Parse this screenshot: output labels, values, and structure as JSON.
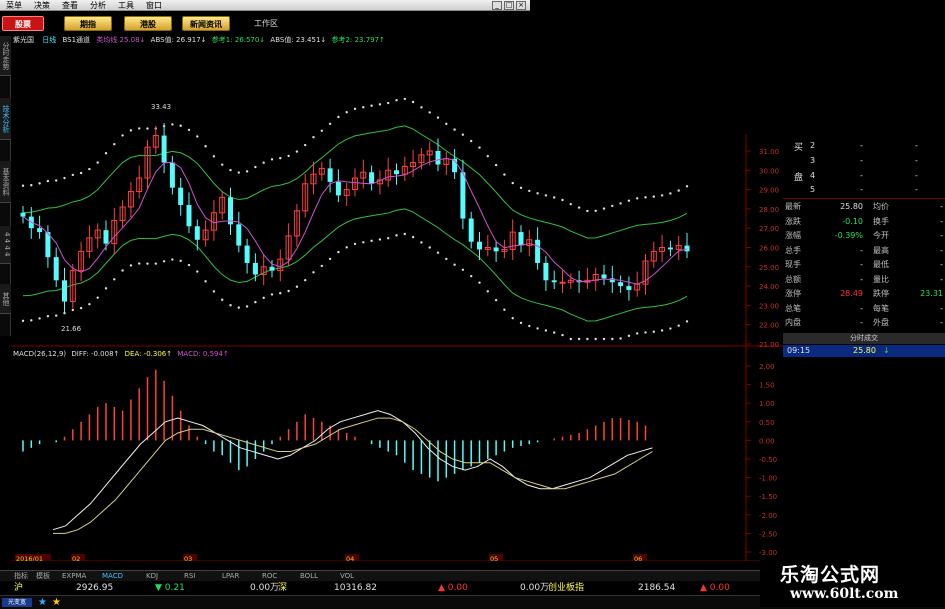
{
  "menu": {
    "items": [
      "菜单",
      "决策",
      "查看",
      "分析",
      "工具",
      "窗口"
    ],
    "window_buttons": [
      "_",
      "□",
      "×"
    ]
  },
  "toolbar": {
    "stock": "股票",
    "futures": "期指",
    "hk": "港股",
    "news": "新闻资讯",
    "workarea": "工作区"
  },
  "left_tabs": [
    "分时走势",
    "技术分析",
    "基本资料",
    "4 4 4 4",
    "其他"
  ],
  "info_header": {
    "name": "紫光国",
    "period": "日线",
    "indicator": "BS1通道",
    "ma_label": "类均线",
    "ma_value": "25.08↓",
    "abs1_label": "ABS值:",
    "abs1_value": "26.917↓",
    "ref1_label": "参考1:",
    "ref1_value": "26.570↓",
    "abs2_label": "ABS值:",
    "abs2_value": "23.451↓",
    "ref2_label": "参考2:",
    "ref2_value": "23.797↑"
  },
  "macd_header": {
    "label": "MACD(26,12,9)",
    "diff": "DIFF: -0.008↑",
    "dea": "DEA: -0.306↑",
    "macd": "MACD: 0.594↑"
  },
  "price_axis": [
    "31.00",
    "30.00",
    "29.00",
    "28.00",
    "27.00",
    "26.00",
    "25.00",
    "24.00",
    "23.00",
    "22.00",
    "21.00"
  ],
  "macd_axis": [
    "2.00",
    "1.50",
    "1.00",
    "0.50",
    "0.00",
    "-0.50",
    "-1.00",
    "-1.50",
    "-2.00",
    "-2.50",
    "-3.00"
  ],
  "annotations": {
    "high": "33.43",
    "low": "21.66"
  },
  "bid_ask": {
    "buy_label": "买",
    "sell_label": "盘",
    "rows": [
      {
        "n": "2",
        "p": "-",
        "v": "-"
      },
      {
        "n": "3",
        "p": "-",
        "v": "-"
      },
      {
        "n": "4",
        "p": "-",
        "v": "-"
      },
      {
        "n": "5",
        "p": "-",
        "v": "-"
      }
    ]
  },
  "quote": [
    {
      "l1": "最新",
      "v1": "25.80",
      "c1": "white",
      "l2": "均价",
      "v2": "-",
      "c2": "white"
    },
    {
      "l1": "涨跌",
      "v1": "-0.10",
      "c1": "green",
      "l2": "换手",
      "v2": "-",
      "c2": "white"
    },
    {
      "l1": "涨幅",
      "v1": "-0.39%",
      "c1": "green",
      "l2": "今开",
      "v2": "-",
      "c2": "white"
    },
    {
      "l1": "总手",
      "v1": "-",
      "c1": "white",
      "l2": "最高",
      "v2": "-",
      "c2": "white"
    },
    {
      "l1": "现手",
      "v1": "-",
      "c1": "white",
      "l2": "最低",
      "v2": "-",
      "c2": "white"
    },
    {
      "l1": "总额",
      "v1": "-",
      "c1": "white",
      "l2": "量比",
      "v2": "-",
      "c2": "white"
    },
    {
      "l1": "涨停",
      "v1": "28.49",
      "c1": "red",
      "l2": "跌停",
      "v2": "23.31",
      "c2": "green"
    },
    {
      "l1": "总笔",
      "v1": "-",
      "c1": "white",
      "l2": "每笔",
      "v2": "-",
      "c2": "white"
    },
    {
      "l1": "内盘",
      "v1": "-",
      "c1": "white",
      "l2": "外盘",
      "v2": "-",
      "c2": "white"
    }
  ],
  "trade": {
    "header": "分时成交",
    "time": "09:15",
    "price": "25.80",
    "arrow": "↓"
  },
  "date_axis": [
    "2016/01",
    "02",
    "03",
    "04",
    "05",
    "06"
  ],
  "tabs": [
    "指标",
    "模板",
    "EXPMA",
    "MACD",
    "KDJ",
    "RSI",
    "LPAR",
    "ROC",
    "BOLL",
    "VOL"
  ],
  "status": {
    "sh_label": "沪",
    "sh_index": "2926.95",
    "sh_change": "▼ 0.21",
    "sh_volume": "0.00万",
    "sz_label": "深",
    "sz_index": "10316.82",
    "sz_change": "▲ 0.00",
    "sz_volume": "0.00万",
    "cy_label": "创业板指",
    "cy_index": "2186.54",
    "cy_change": "▲ 0.00",
    "bottom_label": "光变宽"
  },
  "watermark": {
    "title": "乐淘公式网",
    "url": "www.60lt.com"
  }
}
